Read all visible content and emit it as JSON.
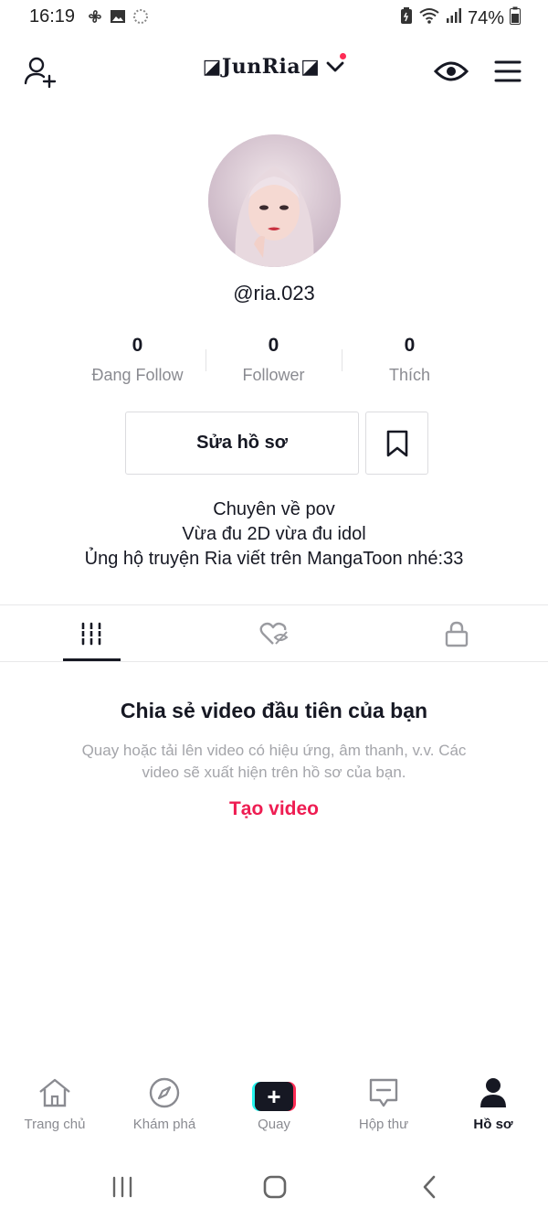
{
  "status_bar": {
    "time": "16:19",
    "battery": "74%",
    "left_icons": [
      "pinwheel-icon",
      "gallery-icon",
      "sync-icon"
    ],
    "right_icons": [
      "battery-saver-icon",
      "wifi-icon",
      "signal-icon",
      "battery-icon"
    ]
  },
  "top_nav": {
    "title": "◪JunRia◪",
    "icons": [
      "add-user-icon",
      "chevron-down-icon",
      "eye-icon",
      "menu-icon"
    ],
    "notification_dot_color": "#fe2c55"
  },
  "profile": {
    "handle": "@ria.023",
    "stats": [
      {
        "value": "0",
        "label": "Đang Follow"
      },
      {
        "value": "0",
        "label": "Follower"
      },
      {
        "value": "0",
        "label": "Thích"
      }
    ],
    "edit_button": "Sửa hồ sơ",
    "bio_lines": [
      "Chuyên về pov",
      "Vừa đu 2D vừa đu idol",
      "Ủng hộ truyện Ria viết trên MangaToon nhé:33"
    ]
  },
  "tabs": {
    "icons": [
      "grid-icon",
      "liked-hidden-icon",
      "lock-icon"
    ],
    "active_index": 0
  },
  "empty_state": {
    "title": "Chia sẻ video đầu tiên của bạn",
    "description": "Quay hoặc tải lên video có hiệu ứng, âm thanh, v.v. Các video sẽ xuất hiện trên hồ sơ của bạn.",
    "action": "Tạo video",
    "action_color": "#ee1d52"
  },
  "bottom_nav": {
    "items": [
      {
        "label": "Trang chủ",
        "icon": "home-icon"
      },
      {
        "label": "Khám phá",
        "icon": "compass-icon"
      },
      {
        "label": "Quay",
        "icon": "plus-icon"
      },
      {
        "label": "Hộp thư",
        "icon": "inbox-icon"
      },
      {
        "label": "Hồ sơ",
        "icon": "profile-icon"
      }
    ],
    "active_index": 4
  },
  "system_nav": {
    "icons": [
      "recents-icon",
      "home-button-icon",
      "back-icon"
    ]
  }
}
